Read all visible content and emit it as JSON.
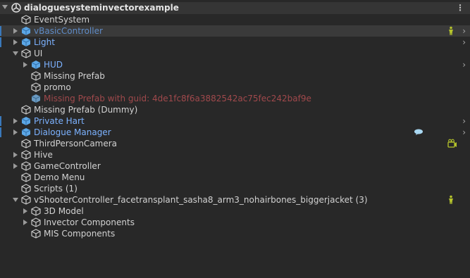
{
  "scene": {
    "name": "dialoguesysteminvectorexample"
  },
  "rows": [
    {
      "label": "EventSystem",
      "indent": 1,
      "fold": "none",
      "icon": "gameobject",
      "style": "normal"
    },
    {
      "label": "vBasicController",
      "indent": 1,
      "fold": "closed",
      "icon": "prefab",
      "style": "prefab-dim",
      "bar": true,
      "selected": true,
      "chevron": true,
      "badge": "character-icon"
    },
    {
      "label": "Light",
      "indent": 1,
      "fold": "closed",
      "icon": "prefab",
      "style": "prefab",
      "bar": true,
      "chevron": true
    },
    {
      "label": "UI",
      "indent": 1,
      "fold": "open",
      "icon": "gameobject",
      "style": "normal"
    },
    {
      "label": "HUD",
      "indent": 2,
      "fold": "closed",
      "icon": "prefab",
      "style": "prefab",
      "chevron": true
    },
    {
      "label": "Missing Prefab",
      "indent": 2,
      "fold": "none",
      "icon": "gameobject",
      "style": "normal"
    },
    {
      "label": "promo",
      "indent": 2,
      "fold": "none",
      "icon": "gameobject",
      "style": "normal"
    },
    {
      "label": "Missing Prefab with guid: 4de1fc8f6a3882542ac75fec242baf9e",
      "indent": 2,
      "fold": "none",
      "icon": "prefab-missing",
      "style": "missing"
    },
    {
      "label": "Missing Prefab (Dummy)",
      "indent": 1,
      "fold": "none",
      "icon": "gameobject",
      "style": "normal"
    },
    {
      "label": "Private Hart",
      "indent": 1,
      "fold": "closed",
      "icon": "prefab",
      "style": "prefab",
      "bar": true,
      "chevron": true
    },
    {
      "label": "Dialogue Manager",
      "indent": 1,
      "fold": "closed",
      "icon": "prefab",
      "style": "prefab",
      "bar": true,
      "chevron": true,
      "badge": "dialogue-icon"
    },
    {
      "label": "ThirdPersonCamera",
      "indent": 1,
      "fold": "none",
      "icon": "gameobject",
      "style": "normal",
      "badge": "camera-icon"
    },
    {
      "label": "Hive",
      "indent": 1,
      "fold": "closed",
      "icon": "gameobject",
      "style": "normal"
    },
    {
      "label": "GameController",
      "indent": 1,
      "fold": "closed",
      "icon": "gameobject",
      "style": "normal"
    },
    {
      "label": "Demo Menu",
      "indent": 1,
      "fold": "none",
      "icon": "gameobject",
      "style": "normal"
    },
    {
      "label": "Scripts (1)",
      "indent": 1,
      "fold": "none",
      "icon": "gameobject",
      "style": "normal"
    },
    {
      "label": "vShooterController_facetransplant_sasha8_arm3_nohairbones_biggerjacket (3)",
      "indent": 1,
      "fold": "open",
      "icon": "gameobject",
      "style": "normal",
      "badge": "character-icon"
    },
    {
      "label": "3D Model",
      "indent": 2,
      "fold": "closed",
      "icon": "gameobject",
      "style": "normal"
    },
    {
      "label": "Invector Components",
      "indent": 2,
      "fold": "closed",
      "icon": "gameobject",
      "style": "normal"
    },
    {
      "label": "MIS Components",
      "indent": 2,
      "fold": "none",
      "icon": "gameobject",
      "style": "normal"
    }
  ],
  "colors": {
    "background": "#282828",
    "header": "#353535",
    "prefab_text": "#7cb2ff",
    "missing_text": "#a0494c",
    "selection_bar": "#3a79bb",
    "badge_green": "#b5c42c"
  }
}
